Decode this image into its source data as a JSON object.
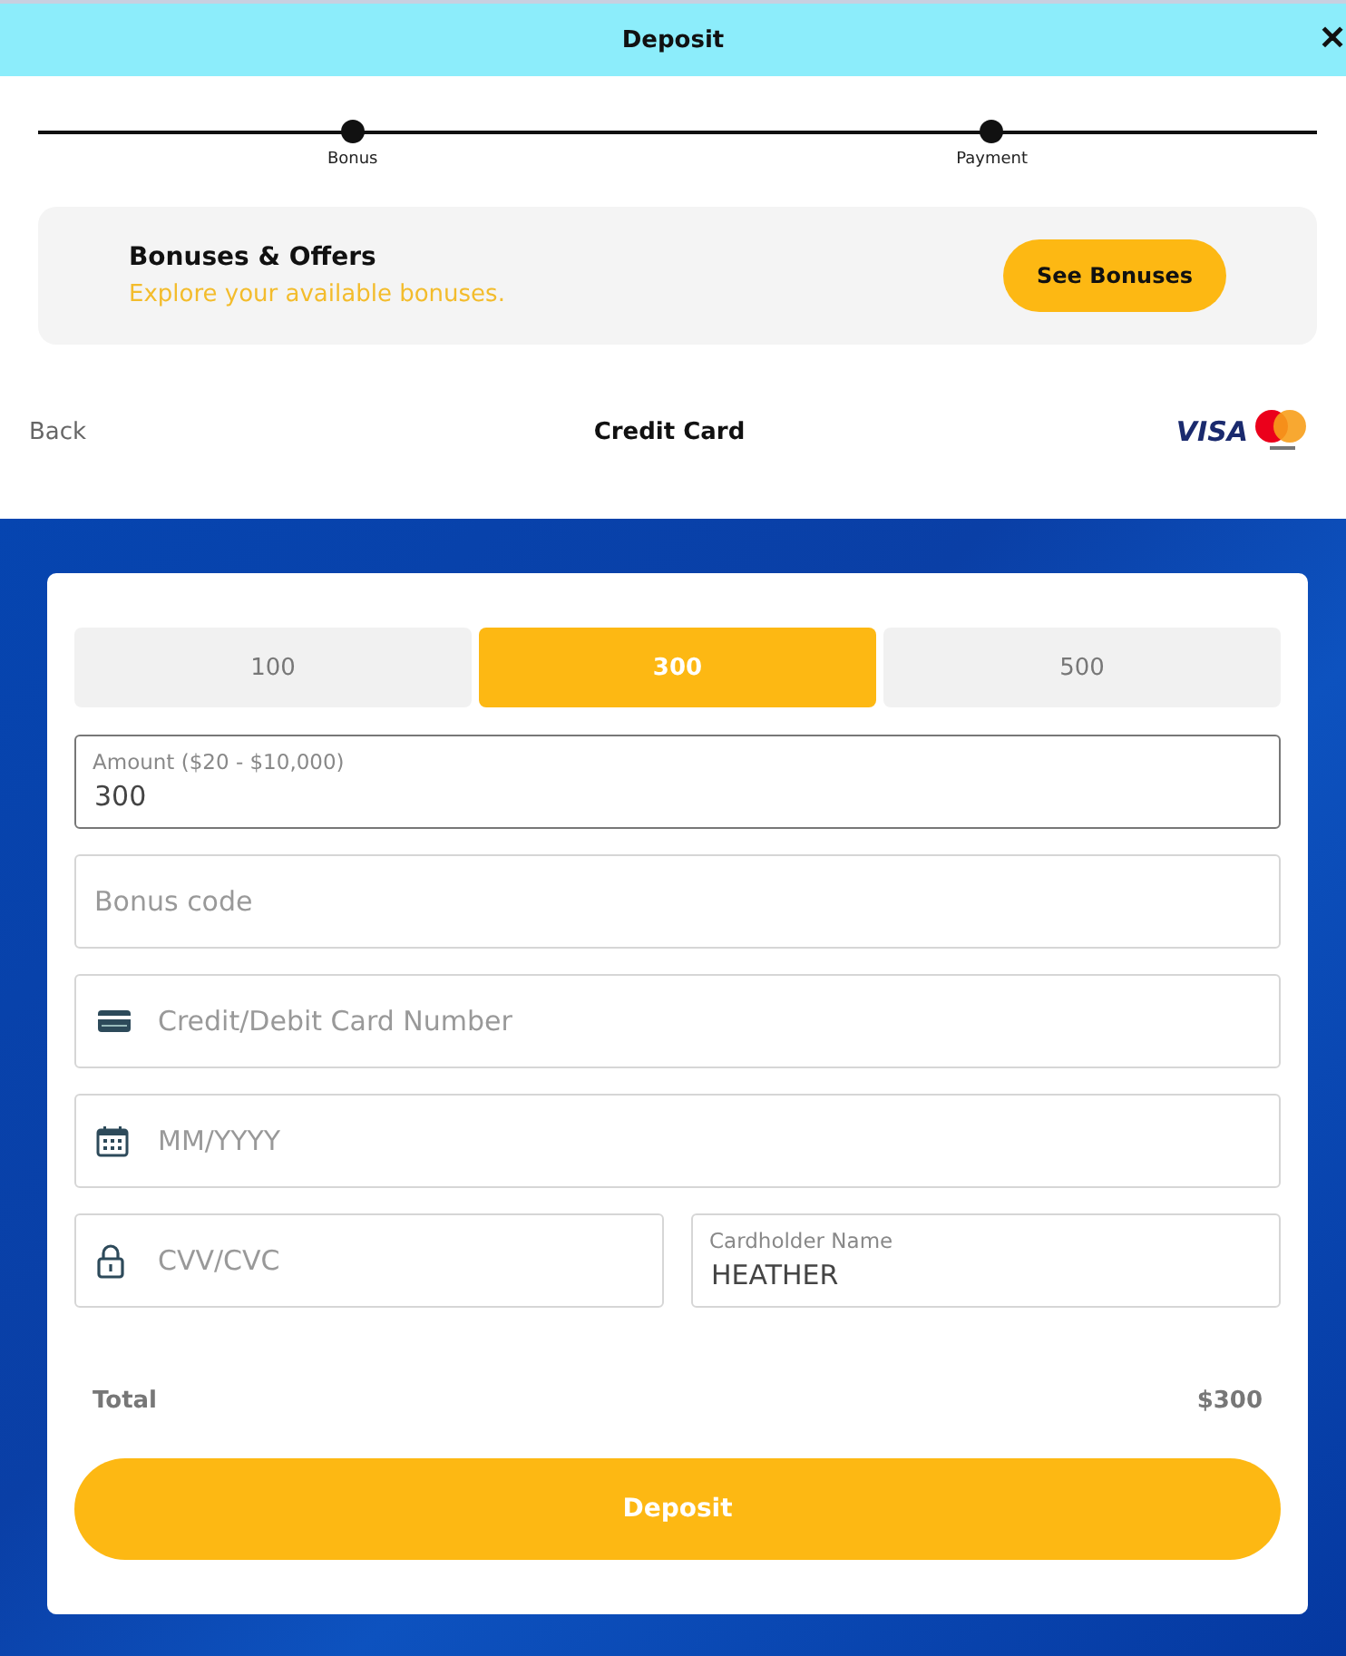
{
  "header": {
    "title": "Deposit",
    "close": "✕"
  },
  "steps": [
    {
      "label": "Bonus"
    },
    {
      "label": "Payment"
    }
  ],
  "bonus_panel": {
    "title": "Bonuses & Offers",
    "subtitle": "Explore your available bonuses.",
    "button": "See Bonuses"
  },
  "method_bar": {
    "back": "Back",
    "title": "Credit Card",
    "card_brand": "VISA"
  },
  "presets": [
    {
      "label": "100",
      "selected": false
    },
    {
      "label": "300",
      "selected": true
    },
    {
      "label": "500",
      "selected": false
    }
  ],
  "fields": [
    {
      "kind": "labeled",
      "label": "Amount ($20 - $10,000)",
      "value": "300",
      "focused": true
    },
    {
      "kind": "plain",
      "placeholder": "Bonus code",
      "focused": false
    },
    {
      "kind": "card",
      "placeholder": "Credit/Debit Card Number",
      "focused": false
    },
    {
      "kind": "date",
      "placeholder": "MM/YYYY",
      "focused": false
    }
  ],
  "pair_fields": [
    {
      "kind": "lock",
      "placeholder": "CVV/CVC",
      "focused": false
    },
    {
      "kind": "labeled",
      "label": "Cardholder Name",
      "value": "HEATHER",
      "focused": false
    }
  ],
  "total": {
    "label": "Total",
    "value": "$300"
  },
  "submit": "Deposit"
}
